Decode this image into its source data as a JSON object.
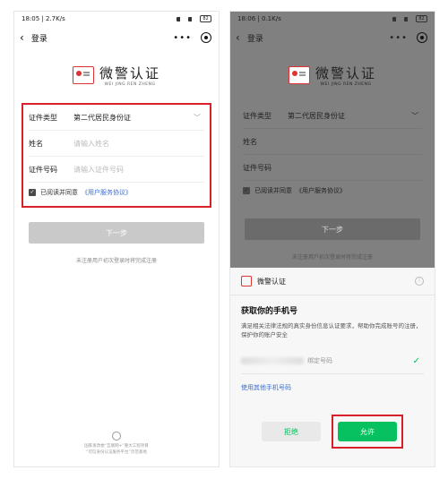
{
  "left": {
    "status": {
      "time_speed": "18:05 | 2.7K/s",
      "battery": "82"
    },
    "nav": {
      "title": "登录",
      "more": "•••"
    },
    "logo": {
      "title": "微警认证",
      "subtitle": "WEI JING REN ZHENG"
    },
    "form": {
      "doc_type_label": "证件类型",
      "doc_type_value": "第二代居民身份证",
      "name_label": "姓名",
      "name_placeholder": "请输入姓名",
      "id_label": "证件号码",
      "id_placeholder": "请输入证件号码",
      "agree_text": "已阅读并同意",
      "agree_link": "《用户服务协议》"
    },
    "next_button": "下一步",
    "hint": "未注册用户初次登录时将完成注册",
    "footer": {
      "line1": "国家发改委“互联网+”重大工程项目",
      "line2": "“可信身份认证服务平台”示范基地"
    }
  },
  "right": {
    "status": {
      "time_speed": "18:06 | 0.1K/s",
      "battery": "82"
    },
    "nav": {
      "title": "登录",
      "more": "•••"
    },
    "logo": {
      "title": "微警认证",
      "subtitle": "WEI JING REN ZHENG"
    },
    "form": {
      "doc_type_label": "证件类型",
      "doc_type_value": "第二代居民身份证",
      "name_label": "姓名",
      "id_label": "证件号码",
      "agree_text": "已阅读并同意",
      "agree_link": "《用户服务协议》"
    },
    "next_button": "下一步",
    "hint": "未注册用户初次登录时将完成注册",
    "sheet": {
      "app_name": "微警认证",
      "title": "获取你的手机号",
      "desc": "满足相关法律法规的真实身份信息认证要求，帮助你完成账号的注册，保护你的账户安全",
      "phone_tag": "绑定号码",
      "other": "使用其他手机号码",
      "reject": "拒绝",
      "allow": "允许"
    }
  }
}
